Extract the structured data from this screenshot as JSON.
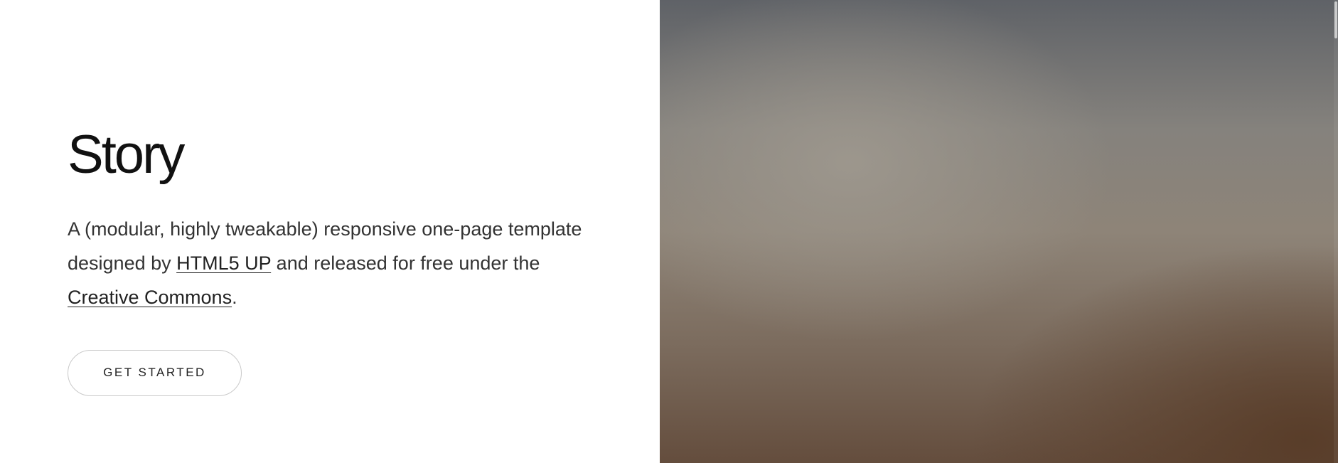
{
  "hero": {
    "title": "Story",
    "description": {
      "part1": "A (modular, highly tweakable) responsive one-page template designed by ",
      "link1": "HTML5 UP",
      "part2": " and released for free under the ",
      "link2": "Creative Commons",
      "part3": "."
    },
    "cta_label": "GET STARTED"
  },
  "colors": {
    "background": "#ffffff",
    "text": "#222222",
    "button_border": "#c9c9c9"
  }
}
